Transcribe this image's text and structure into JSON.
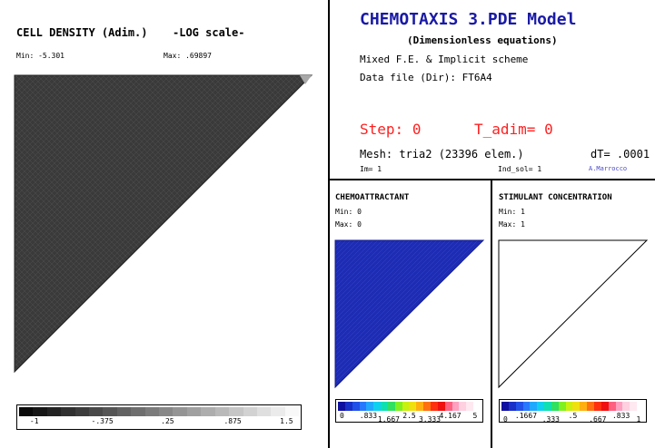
{
  "cell_density": {
    "title": "CELL DENSITY (Adim.)",
    "scale_note": "-LOG scale-",
    "min_label": "Min:",
    "min_value": "-5.301",
    "max_label": "Max:",
    "max_value": ".69897",
    "colorbar_ticks": [
      "-1",
      "-.375",
      ".25",
      ".875",
      "1.5"
    ]
  },
  "header": {
    "title": "CHEMOTAXIS  3.PDE Model",
    "subtitle": "(Dimensionless equations)",
    "scheme": "Mixed F.E. & Implicit scheme",
    "datafile_label": "Data file (Dir):",
    "datafile_value": "FT6A4",
    "step_label": "Step:",
    "step_value": "0",
    "tadim_label": "T_adim=",
    "tadim_value": "0",
    "mesh_label": "Mesh:",
    "mesh_value": "tria2 (23396 elem.)",
    "dt_label": "dT=",
    "dt_value": ".0001",
    "im_label": "Im=",
    "im_value": "1",
    "indsol_label": "Ind_sol=",
    "indsol_value": "1",
    "author": "A.Marrocco"
  },
  "chemoattractant": {
    "title": "CHEMOATTRACTANT",
    "min_label": "Min:",
    "min_value": "0",
    "max_label": "Max:",
    "max_value": "0",
    "colorbar_ticks_top": [
      "0",
      ".833",
      "2.5",
      "4.167",
      "5"
    ],
    "colorbar_ticks_low": [
      "1.667",
      "3.333"
    ],
    "fill_color": "#1e2cb4"
  },
  "stimulant": {
    "title": "STIMULANT CONCENTRATION",
    "min_label": "Min:",
    "min_value": "1",
    "max_label": "Max:",
    "max_value": "1",
    "colorbar_ticks_top": [
      ".1667",
      ".5",
      ".833"
    ],
    "colorbar_ticks_low": [
      "0",
      ".333",
      ".667",
      "1"
    ]
  },
  "colors": {
    "header_blue": "#1a1aa6",
    "status_red": "#ff2020",
    "author_blue": "#4a4ac8",
    "density_gray": "#3c3c3c"
  }
}
